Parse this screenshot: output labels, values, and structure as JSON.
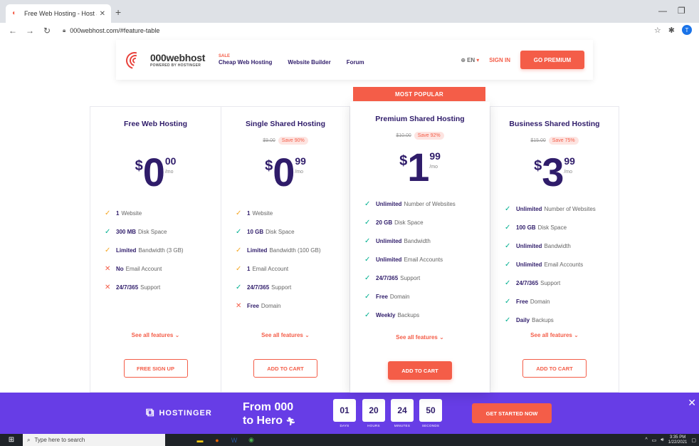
{
  "browser": {
    "tab_title": "Free Web Hosting - Host a Webs",
    "url": "000webhost.com/#feature-table",
    "profile_initial": "T"
  },
  "header": {
    "logo_name": "000webhost",
    "logo_sub": "POWERED BY HOSTINGER",
    "sale": "SALE",
    "nav": [
      "Cheap Web Hosting",
      "Website Builder",
      "Forum"
    ],
    "lang": "EN",
    "signin": "SIGN IN",
    "go_premium": "GO PREMIUM"
  },
  "most_popular": "MOST POPULAR",
  "plans": [
    {
      "title": "Free Web Hosting",
      "old_price": "",
      "save": "",
      "currency": "$",
      "whole": "0",
      "cents": "00",
      "per": "/mo",
      "features": [
        {
          "mark": "half",
          "bold": "1",
          "rest": "Website"
        },
        {
          "mark": "ok",
          "bold": "300 MB",
          "rest": "Disk Space"
        },
        {
          "mark": "half",
          "bold": "Limited",
          "rest": "Bandwidth (3 GB)"
        },
        {
          "mark": "no",
          "bold": "No",
          "rest": "Email Account"
        },
        {
          "mark": "no",
          "bold": "24/7/365",
          "rest": "Support"
        }
      ],
      "see_all": "See all features",
      "button": "FREE SIGN UP"
    },
    {
      "title": "Single Shared Hosting",
      "old_price": "$9.00",
      "save": "Save 90%",
      "currency": "$",
      "whole": "0",
      "cents": "99",
      "per": "/mo",
      "features": [
        {
          "mark": "half",
          "bold": "1",
          "rest": "Website"
        },
        {
          "mark": "ok",
          "bold": "10 GB",
          "rest": "Disk Space"
        },
        {
          "mark": "half",
          "bold": "Limited",
          "rest": "Bandwidth (100 GB)"
        },
        {
          "mark": "half",
          "bold": "1",
          "rest": "Email Account"
        },
        {
          "mark": "ok",
          "bold": "24/7/365",
          "rest": "Support"
        },
        {
          "mark": "no",
          "bold": "Free",
          "rest": "Domain"
        }
      ],
      "see_all": "See all features",
      "button": "ADD TO CART"
    },
    {
      "title": "Premium Shared Hosting",
      "old_price": "$10.00",
      "save": "Save 92%",
      "currency": "$",
      "whole": "1",
      "cents": "99",
      "per": "/mo",
      "features": [
        {
          "mark": "ok",
          "bold": "Unlimited",
          "rest": "Number of Websites"
        },
        {
          "mark": "ok",
          "bold": "20 GB",
          "rest": "Disk Space"
        },
        {
          "mark": "ok",
          "bold": "Unlimited",
          "rest": "Bandwidth"
        },
        {
          "mark": "ok",
          "bold": "Unlimited",
          "rest": "Email Accounts"
        },
        {
          "mark": "ok",
          "bold": "24/7/365",
          "rest": "Support"
        },
        {
          "mark": "ok",
          "bold": "Free",
          "rest": "Domain"
        },
        {
          "mark": "ok",
          "bold": "Weekly",
          "rest": "Backups"
        }
      ],
      "see_all": "See all features",
      "button": "ADD TO CART"
    },
    {
      "title": "Business Shared Hosting",
      "old_price": "$15.00",
      "save": "Save 75%",
      "currency": "$",
      "whole": "3",
      "cents": "99",
      "per": "/mo",
      "features": [
        {
          "mark": "ok",
          "bold": "Unlimited",
          "rest": "Number of Websites"
        },
        {
          "mark": "ok",
          "bold": "100 GB",
          "rest": "Disk Space"
        },
        {
          "mark": "ok",
          "bold": "Unlimited",
          "rest": "Bandwidth"
        },
        {
          "mark": "ok",
          "bold": "Unlimited",
          "rest": "Email Accounts"
        },
        {
          "mark": "ok",
          "bold": "24/7/365",
          "rest": "Support"
        },
        {
          "mark": "ok",
          "bold": "Free",
          "rest": "Domain"
        },
        {
          "mark": "ok",
          "bold": "Daily",
          "rest": "Backups"
        }
      ],
      "see_all": "See all features",
      "button": "ADD TO CART"
    }
  ],
  "promo": {
    "brand": "HOSTINGER",
    "line1": "From 000",
    "line2": "to Hero",
    "counters": [
      {
        "value": "01",
        "label": "DAYS"
      },
      {
        "value": "20",
        "label": "HOURS"
      },
      {
        "value": "24",
        "label": "MINUTES"
      },
      {
        "value": "50",
        "label": "SECONDS"
      }
    ],
    "cta": "GET STARTED NOW"
  },
  "taskbar": {
    "search_placeholder": "Type here to search",
    "time": "3:35 PM",
    "date": "1/22/2021"
  }
}
